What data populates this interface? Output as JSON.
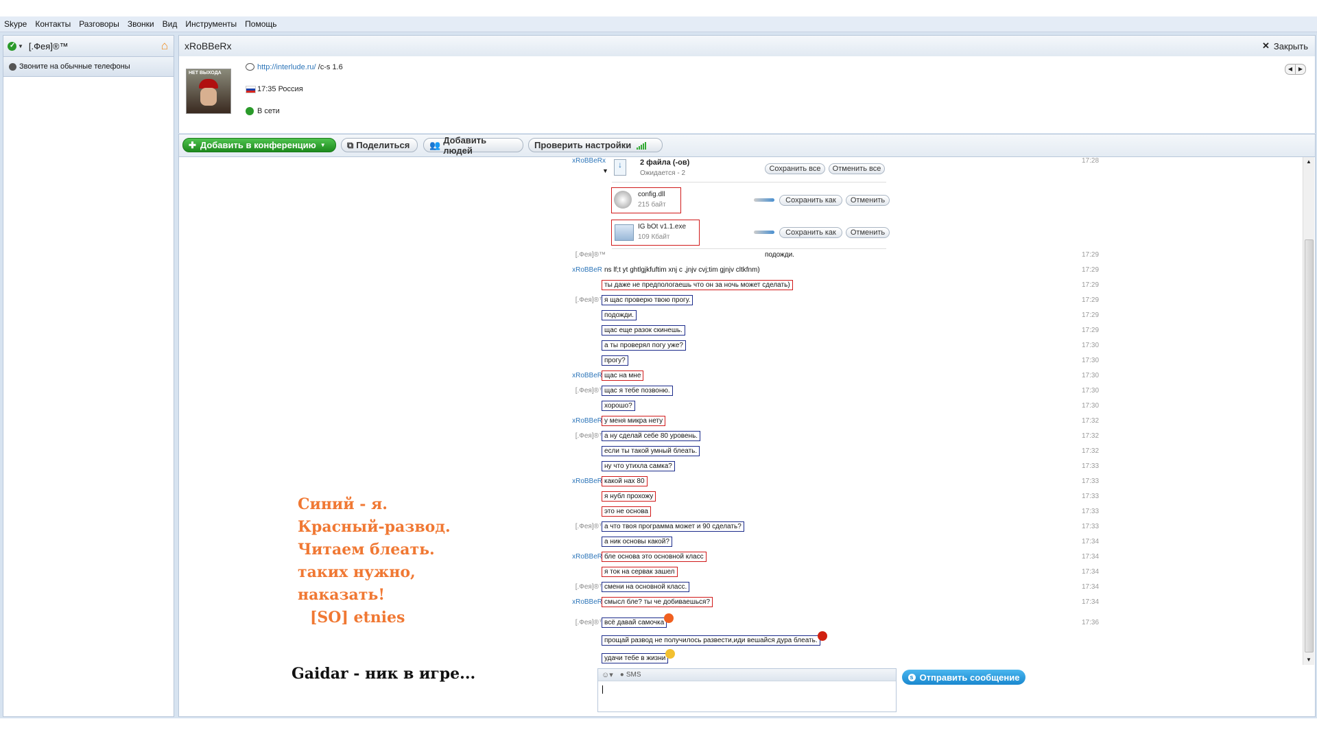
{
  "menu": [
    "Skype",
    "Контакты",
    "Разговоры",
    "Звонки",
    "Вид",
    "Инструменты",
    "Помощь"
  ],
  "profile": {
    "name": "[.Фея]®™"
  },
  "call_phones_label": "Звоните на обычные телефоны",
  "contact": {
    "name": "xRoBBeRx",
    "close_label": "Закрыть",
    "avatar_caption": "НЕТ ВЫХОДА",
    "mood_link": "http://interlude.ru/",
    "mood_text": " /c-s 1.6",
    "local_time": "17:35 Россия",
    "status": "В сети"
  },
  "toolbar": {
    "add_conference": "Добавить в конференцию",
    "share": "Поделиться",
    "add_people": "Добавить людей",
    "check_settings": "Проверить настройки"
  },
  "transfer": {
    "sender": "xRoBBeRx",
    "time": "17:28",
    "title": "2 файла (-ов)",
    "status": "Ожидается - 2",
    "save_all": "Сохранить все",
    "cancel_all": "Отменить все",
    "save_as": "Сохранить как",
    "cancel": "Отменить",
    "files": [
      {
        "name": "config.dll",
        "size": "215 байт"
      },
      {
        "name": "IG bOt v1.1.exe",
        "size": "109 Кбайт"
      }
    ]
  },
  "messages": [
    {
      "sender": "[.Фея]®™",
      "text": "подожди.",
      "time": "17:29"
    },
    {
      "sender": "xRoBBeRx",
      "text": "ns lf;t yt ghtlgjkfuftim xnj c ,jnjv cvj;tim gjnjv cltkfnm)",
      "time": "17:29"
    },
    {
      "sender": "",
      "text": "ты даже не предпологаешь что он за ночь может сделать)",
      "time": "17:29"
    },
    {
      "sender": "[.Фея]®™",
      "text": "я щас проверю твою прогу.",
      "time": "17:29"
    },
    {
      "sender": "",
      "text": "подожди.",
      "time": "17:29"
    },
    {
      "sender": "",
      "text": "щас еще разок скинешь.",
      "time": "17:29"
    },
    {
      "sender": "",
      "text": "а ты проверял погу уже?",
      "time": "17:30"
    },
    {
      "sender": "",
      "text": "прогу?",
      "time": "17:30"
    },
    {
      "sender": "xRoBBeRx",
      "text": "щас на мне",
      "time": "17:30"
    },
    {
      "sender": "[.Фея]®™",
      "text": "щас я тебе позвоню.",
      "time": "17:30"
    },
    {
      "sender": "",
      "text": "хорошо?",
      "time": "17:30"
    },
    {
      "sender": "xRoBBeRx",
      "text": "у меня микра нету",
      "time": "17:32"
    },
    {
      "sender": "[.Фея]®™",
      "text": "а ну сделай себе 80 уровень.",
      "time": "17:32"
    },
    {
      "sender": "",
      "text": "если ты такой умный блеать.",
      "time": "17:32"
    },
    {
      "sender": "",
      "text": "ну что утихла самка?",
      "time": "17:33"
    },
    {
      "sender": "xRoBBeRx",
      "text": "какой нах 80",
      "time": "17:33"
    },
    {
      "sender": "",
      "text": "я нубл прохожу",
      "time": "17:33"
    },
    {
      "sender": "",
      "text": "это не основа",
      "time": "17:33"
    },
    {
      "sender": "[.Фея]®™",
      "text": "а что твоя программа может и 90 сделать?",
      "time": "17:33"
    },
    {
      "sender": "",
      "text": "а ник основы какой?",
      "time": "17:34"
    },
    {
      "sender": "xRoBBeRx",
      "text": "бле основа это основной класс",
      "time": "17:34"
    },
    {
      "sender": "",
      "text": "я ток на сервак зашел",
      "time": "17:34"
    },
    {
      "sender": "[.Фея]®™",
      "text": "смени на основной класс.",
      "time": "17:34"
    },
    {
      "sender": "xRoBBeRx",
      "text": "смысл бле? ты че добиваешься?",
      "time": "17:34"
    },
    {
      "sender": "[.Фея]®™",
      "text": "всё давай самочка",
      "time": "17:36"
    },
    {
      "sender": "",
      "text": "прощай развод не получилось развести,иди вешайся дура блеать.",
      "time": ""
    },
    {
      "sender": "",
      "text": "удачи тебе в жизни",
      "time": ""
    }
  ],
  "overlay_lines": [
    "Синий - я.",
    "Красный-развод.",
    "Читаем блеать.",
    "таких нужно,",
    "наказать!",
    "[SO] etnies"
  ],
  "overlay_note": "Gaidar - ник в игре...",
  "input": {
    "sms_label": "SMS",
    "send_label": "Отправить сообщение"
  },
  "colors": {
    "accent_blue": "#2b74b8",
    "highlight_red": "#d01818",
    "highlight_blue": "#1a2a8a",
    "overlay_orange": "#f07833",
    "green": "#2a9a2a"
  }
}
